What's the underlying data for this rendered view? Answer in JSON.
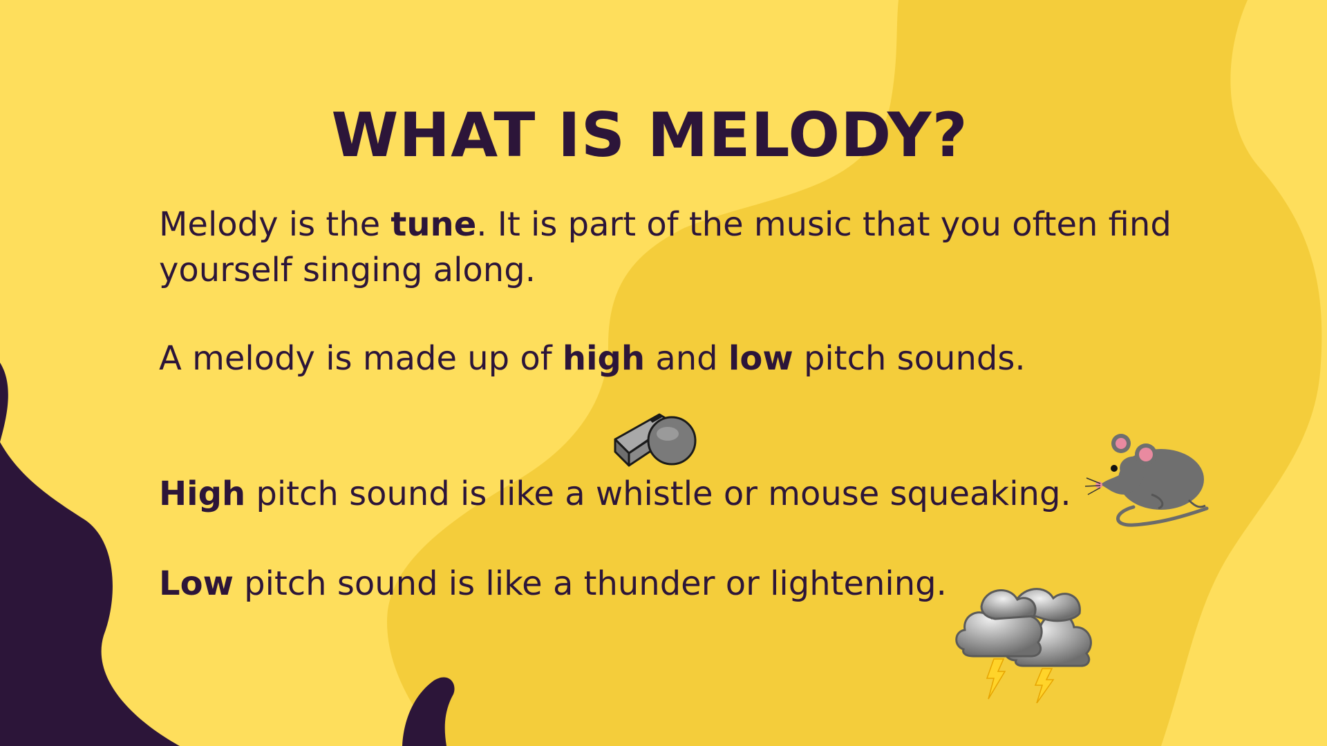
{
  "slide": {
    "title": "WHAT IS MELODY?",
    "p1": {
      "before": "Melody is the ",
      "bold": "tune",
      "after": ". It is part of the music that you often find",
      "line2": "yourself singing along."
    },
    "p2": {
      "before": "A melody is made up of ",
      "bold1": "high",
      "middle": " and ",
      "bold2": "low",
      "after": " pitch sounds."
    },
    "p3": {
      "bold": "High",
      "after": " pitch sound is like a whistle or mouse squeaking."
    },
    "p4": {
      "bold": "Low",
      "after": " pitch sound is like a thunder or lightening."
    }
  },
  "icons": [
    "whistle-icon",
    "mouse-icon",
    "storm-cloud-icon"
  ],
  "colors": {
    "background": "#FEDE5C",
    "blob": "#F4CD3B",
    "dark_purple": "#2C1539",
    "text": "#2C1539"
  }
}
